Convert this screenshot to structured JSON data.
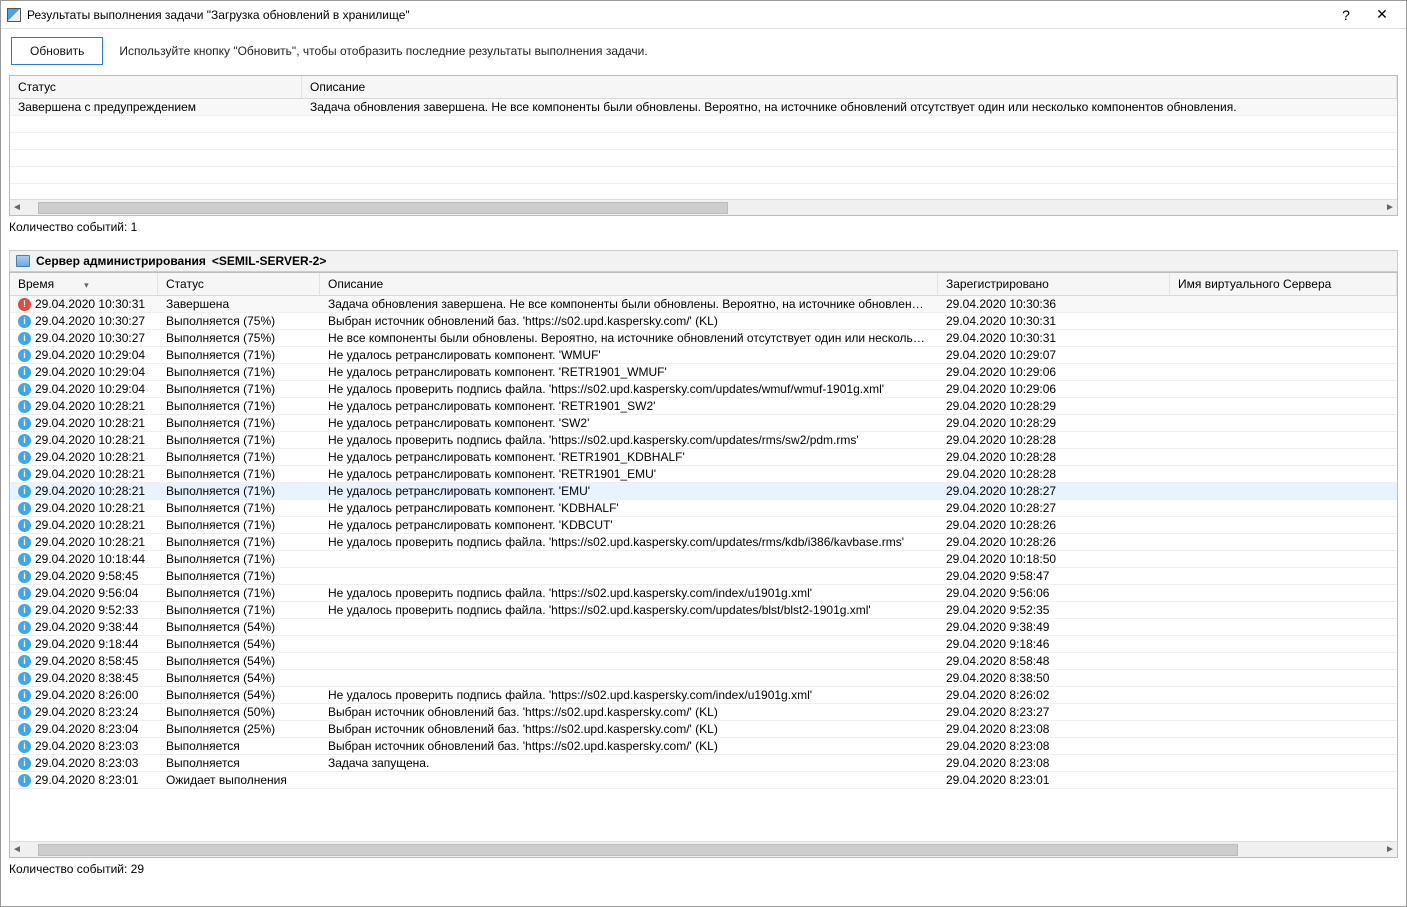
{
  "window": {
    "title": "Результаты выполнения задачи \"Загрузка обновлений в хранилище\""
  },
  "toolbar": {
    "refresh_label": "Обновить",
    "hint": "Используйте кнопку \"Обновить\", чтобы отобразить последние результаты выполнения задачи."
  },
  "summary": {
    "headers": {
      "status": "Статус",
      "description": "Описание"
    },
    "row": {
      "status": "Завершена с предупреждением",
      "description": "Задача обновления завершена. Не все компоненты были обновлены. Вероятно, на источнике обновлений отсутствует один или несколько компонентов обновления."
    },
    "count_label": "Количество событий: 1"
  },
  "server": {
    "label_prefix": "Сервер администрирования",
    "name": "<SEMIL-SERVER-2>"
  },
  "events": {
    "headers": {
      "time": "Время",
      "status": "Статус",
      "description": "Описание",
      "registered": "Зарегистрировано",
      "virtual": "Имя виртуального Сервера"
    },
    "rows": [
      {
        "icon": "err",
        "time": "29.04.2020 10:30:31",
        "status": "Завершена",
        "desc": "Задача обновления завершена. Не все компоненты были обновлены. Вероятно, на источнике обновлений отсутствует...",
        "reg": "29.04.2020 10:30:36",
        "sel": false,
        "first": true
      },
      {
        "icon": "info",
        "time": "29.04.2020 10:30:27",
        "status": "Выполняется (75%)",
        "desc": "Выбран источник обновлений баз. 'https://s02.upd.kaspersky.com/' (KL)",
        "reg": "29.04.2020 10:30:31"
      },
      {
        "icon": "info",
        "time": "29.04.2020 10:30:27",
        "status": "Выполняется (75%)",
        "desc": "Не все компоненты были обновлены. Вероятно, на источнике обновлений отсутствует один или несколько компонент...",
        "reg": "29.04.2020 10:30:31"
      },
      {
        "icon": "info",
        "time": "29.04.2020 10:29:04",
        "status": "Выполняется (71%)",
        "desc": "Не удалось ретранслировать компонент. 'WMUF'",
        "reg": "29.04.2020 10:29:07"
      },
      {
        "icon": "info",
        "time": "29.04.2020 10:29:04",
        "status": "Выполняется (71%)",
        "desc": "Не удалось ретранслировать компонент. 'RETR1901_WMUF'",
        "reg": "29.04.2020 10:29:06"
      },
      {
        "icon": "info",
        "time": "29.04.2020 10:29:04",
        "status": "Выполняется (71%)",
        "desc": "Не удалось проверить подпись файла. 'https://s02.upd.kaspersky.com/updates/wmuf/wmuf-1901g.xml'",
        "reg": "29.04.2020 10:29:06"
      },
      {
        "icon": "info",
        "time": "29.04.2020 10:28:21",
        "status": "Выполняется (71%)",
        "desc": "Не удалось ретранслировать компонент. 'RETR1901_SW2'",
        "reg": "29.04.2020 10:28:29"
      },
      {
        "icon": "info",
        "time": "29.04.2020 10:28:21",
        "status": "Выполняется (71%)",
        "desc": "Не удалось ретранслировать компонент. 'SW2'",
        "reg": "29.04.2020 10:28:29"
      },
      {
        "icon": "info",
        "time": "29.04.2020 10:28:21",
        "status": "Выполняется (71%)",
        "desc": "Не удалось проверить подпись файла. 'https://s02.upd.kaspersky.com/updates/rms/sw2/pdm.rms'",
        "reg": "29.04.2020 10:28:28"
      },
      {
        "icon": "info",
        "time": "29.04.2020 10:28:21",
        "status": "Выполняется (71%)",
        "desc": "Не удалось ретранслировать компонент. 'RETR1901_KDBHALF'",
        "reg": "29.04.2020 10:28:28"
      },
      {
        "icon": "info",
        "time": "29.04.2020 10:28:21",
        "status": "Выполняется (71%)",
        "desc": "Не удалось ретранслировать компонент. 'RETR1901_EMU'",
        "reg": "29.04.2020 10:28:28"
      },
      {
        "icon": "info",
        "time": "29.04.2020 10:28:21",
        "status": "Выполняется (71%)",
        "desc": "Не удалось ретранслировать компонент. 'EMU'",
        "reg": "29.04.2020 10:28:27",
        "sel": true
      },
      {
        "icon": "info",
        "time": "29.04.2020 10:28:21",
        "status": "Выполняется (71%)",
        "desc": "Не удалось ретранслировать компонент. 'KDBHALF'",
        "reg": "29.04.2020 10:28:27"
      },
      {
        "icon": "info",
        "time": "29.04.2020 10:28:21",
        "status": "Выполняется (71%)",
        "desc": "Не удалось ретранслировать компонент. 'KDBCUT'",
        "reg": "29.04.2020 10:28:26"
      },
      {
        "icon": "info",
        "time": "29.04.2020 10:28:21",
        "status": "Выполняется (71%)",
        "desc": "Не удалось проверить подпись файла. 'https://s02.upd.kaspersky.com/updates/rms/kdb/i386/kavbase.rms'",
        "reg": "29.04.2020 10:28:26"
      },
      {
        "icon": "info",
        "time": "29.04.2020 10:18:44",
        "status": "Выполняется (71%)",
        "desc": "",
        "reg": "29.04.2020 10:18:50"
      },
      {
        "icon": "info",
        "time": "29.04.2020 9:58:45",
        "status": "Выполняется (71%)",
        "desc": "",
        "reg": "29.04.2020 9:58:47"
      },
      {
        "icon": "info",
        "time": "29.04.2020 9:56:04",
        "status": "Выполняется (71%)",
        "desc": "Не удалось проверить подпись файла. 'https://s02.upd.kaspersky.com/index/u1901g.xml'",
        "reg": "29.04.2020 9:56:06"
      },
      {
        "icon": "info",
        "time": "29.04.2020 9:52:33",
        "status": "Выполняется (71%)",
        "desc": "Не удалось проверить подпись файла. 'https://s02.upd.kaspersky.com/updates/blst/blst2-1901g.xml'",
        "reg": "29.04.2020 9:52:35"
      },
      {
        "icon": "info",
        "time": "29.04.2020 9:38:44",
        "status": "Выполняется (54%)",
        "desc": "",
        "reg": "29.04.2020 9:38:49"
      },
      {
        "icon": "info",
        "time": "29.04.2020 9:18:44",
        "status": "Выполняется (54%)",
        "desc": "",
        "reg": "29.04.2020 9:18:46"
      },
      {
        "icon": "info",
        "time": "29.04.2020 8:58:45",
        "status": "Выполняется (54%)",
        "desc": "",
        "reg": "29.04.2020 8:58:48"
      },
      {
        "icon": "info",
        "time": "29.04.2020 8:38:45",
        "status": "Выполняется (54%)",
        "desc": "",
        "reg": "29.04.2020 8:38:50"
      },
      {
        "icon": "info",
        "time": "29.04.2020 8:26:00",
        "status": "Выполняется (54%)",
        "desc": "Не удалось проверить подпись файла. 'https://s02.upd.kaspersky.com/index/u1901g.xml'",
        "reg": "29.04.2020 8:26:02"
      },
      {
        "icon": "info",
        "time": "29.04.2020 8:23:24",
        "status": "Выполняется (50%)",
        "desc": "Выбран источник обновлений баз. 'https://s02.upd.kaspersky.com/' (KL)",
        "reg": "29.04.2020 8:23:27"
      },
      {
        "icon": "info",
        "time": "29.04.2020 8:23:04",
        "status": "Выполняется (25%)",
        "desc": "Выбран источник обновлений баз. 'https://s02.upd.kaspersky.com/' (KL)",
        "reg": "29.04.2020 8:23:08"
      },
      {
        "icon": "info",
        "time": "29.04.2020 8:23:03",
        "status": "Выполняется",
        "desc": "Выбран источник обновлений баз. 'https://s02.upd.kaspersky.com/' (KL)",
        "reg": "29.04.2020 8:23:08"
      },
      {
        "icon": "info",
        "time": "29.04.2020 8:23:03",
        "status": "Выполняется",
        "desc": "Задача запущена.",
        "reg": "29.04.2020 8:23:08"
      },
      {
        "icon": "info",
        "time": "29.04.2020 8:23:01",
        "status": "Ожидает выполнения",
        "desc": "",
        "reg": "29.04.2020 8:23:01"
      }
    ],
    "count_label": "Количество событий: 29"
  }
}
